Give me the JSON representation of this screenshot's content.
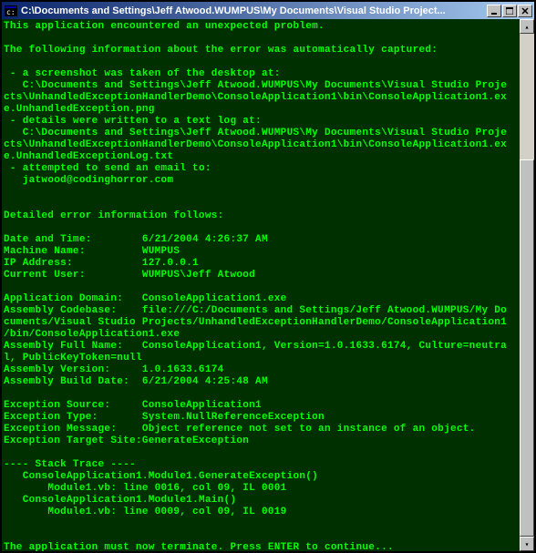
{
  "window": {
    "title": "C:\\Documents and Settings\\Jeff Atwood.WUMPUS\\My Documents\\Visual Studio Project..."
  },
  "icons": {
    "app": "console-icon",
    "minimize": "minimize-icon",
    "maximize": "maximize-icon",
    "close": "close-icon",
    "scroll_up": "scroll-up-icon",
    "scroll_down": "scroll-down-icon"
  },
  "scrollbar": {
    "thumb_top_pct": 25,
    "thumb_height_pct": 75
  },
  "console": {
    "intro": "This application encountered an unexpected problem.",
    "captured_header": "The following information about the error was automatically captured:",
    "captured_items": [
      " - a screenshot was taken of the desktop at:",
      "   C:\\Documents and Settings\\Jeff Atwood.WUMPUS\\My Documents\\Visual Studio Projects\\UnhandledExceptionHandlerDemo\\ConsoleApplication1\\bin\\ConsoleApplication1.exe.UnhandledException.png",
      " - details were written to a text log at:",
      "   C:\\Documents and Settings\\Jeff Atwood.WUMPUS\\My Documents\\Visual Studio Projects\\UnhandledExceptionHandlerDemo\\ConsoleApplication1\\bin\\ConsoleApplication1.exe.UnhandledExceptionLog.txt",
      " - attempted to send an email to:",
      "   jatwood@codinghorror.com"
    ],
    "detail_header": "Detailed error information follows:",
    "fields": [
      {
        "label": "Date and Time:",
        "value": "6/21/2004 4:26:37 AM"
      },
      {
        "label": "Machine Name:",
        "value": "WUMPUS"
      },
      {
        "label": "IP Address:",
        "value": "127.0.0.1"
      },
      {
        "label": "Current User:",
        "value": "WUMPUS\\Jeff Atwood"
      }
    ],
    "assembly_fields": [
      {
        "label": "Application Domain:",
        "value": "ConsoleApplication1.exe"
      },
      {
        "label": "Assembly Codebase:",
        "value": "file:///C:/Documents and Settings/Jeff Atwood.WUMPUS/My Documents/Visual Studio Projects/UnhandledExceptionHandlerDemo/ConsoleApplication1/bin/ConsoleApplication1.exe"
      },
      {
        "label": "Assembly Full Name:",
        "value": "ConsoleApplication1, Version=1.0.1633.6174, Culture=neutral, PublicKeyToken=null"
      },
      {
        "label": "Assembly Version:",
        "value": "1.0.1633.6174"
      },
      {
        "label": "Assembly Build Date:",
        "value": "6/21/2004 4:25:48 AM"
      }
    ],
    "exception_fields": [
      {
        "label": "Exception Source:",
        "value": "ConsoleApplication1"
      },
      {
        "label": "Exception Type:",
        "value": "System.NullReferenceException"
      },
      {
        "label": "Exception Message:",
        "value": "Object reference not set to an instance of an object."
      },
      {
        "label": "Exception Target Site:",
        "value": "GenerateException"
      }
    ],
    "stack_header": "---- Stack Trace ----",
    "stack_lines": [
      "   ConsoleApplication1.Module1.GenerateException()",
      "       Module1.vb: line 0016, col 09, IL 0001",
      "   ConsoleApplication1.Module1.Main()",
      "       Module1.vb: line 0009, col 09, IL 0019"
    ],
    "terminate": "The application must now terminate. Press ENTER to continue..."
  }
}
